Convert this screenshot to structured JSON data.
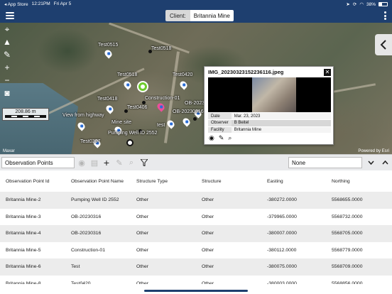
{
  "status_bar": {
    "back_app": "◂ App Store",
    "time": "12:21PM",
    "date": "Fri Apr 5",
    "battery": "38%",
    "battery_level": 0.38
  },
  "nav": {
    "client_label": "Client:",
    "client_value": "Britannia Mine",
    "menu_icon": "hamburger-icon",
    "more_icon": "kebab-icon"
  },
  "map": {
    "scale_label": "208.86 m",
    "attribution_left": "Maxar",
    "attribution_right": "Powered by Esri",
    "markers": [
      {
        "label": "Test0515",
        "kind": "flag"
      },
      {
        "label": "Test0518",
        "kind": "dot"
      },
      {
        "label": "Test0518",
        "kind": "flag"
      },
      {
        "label": "Test0420",
        "kind": "flag"
      },
      {
        "label": "Test0418",
        "kind": "flag"
      },
      {
        "label": "Construction-01",
        "kind": "dot"
      },
      {
        "label": "Test0406",
        "kind": "dot"
      },
      {
        "label": "Test0403",
        "kind": "flag"
      },
      {
        "label": "View from highway",
        "kind": "flag"
      },
      {
        "label": "Mine site",
        "kind": "flag"
      },
      {
        "label": "OB-20230316",
        "kind": "dot"
      },
      {
        "label": "test",
        "kind": "flag"
      },
      {
        "label": "Pumping Well ID 2552",
        "kind": "dot"
      },
      {
        "label": "Test0307",
        "kind": "flag"
      },
      {
        "label": "OB-2023...",
        "kind": "flag"
      }
    ]
  },
  "popup": {
    "title": "IMG_20230323152236116.jpeg",
    "rows": [
      {
        "key": "Date",
        "value": "Mar. 23, 2023"
      },
      {
        "key": "Observer",
        "value": "B Beitel"
      },
      {
        "key": "Facility",
        "value": "Britannia Mine"
      }
    ]
  },
  "toolbar": {
    "layer": "Observation Points",
    "filter_value": "None"
  },
  "table": {
    "columns": [
      "Observation Point Id",
      "Observation Point Name",
      "Structure Type",
      "Structure",
      "Easting",
      "Northing"
    ],
    "rows": [
      [
        "Britannia Mine-2",
        "Pumping Well ID 2552",
        "Other",
        "Other",
        "-380272.0000",
        "5568655.0000"
      ],
      [
        "Britannia Mine-3",
        "OB-20230316",
        "Other",
        "Other",
        "-379965.0000",
        "5568732.0000"
      ],
      [
        "Britannia Mine-4",
        "OB-20230316",
        "Other",
        "Other",
        "-380007.0000",
        "5568705.0000"
      ],
      [
        "Britannia Mine-5",
        "Construction-01",
        "Other",
        "Other",
        "-380112.0000",
        "5568779.0000"
      ],
      [
        "Britannia Mine-6",
        "Test",
        "Other",
        "Other",
        "-380075.0000",
        "5568709.0000"
      ],
      [
        "Britannia Mine-8",
        "Test0420",
        "Other",
        "Other",
        "-380003.0000",
        "5568856.0000"
      ]
    ]
  }
}
